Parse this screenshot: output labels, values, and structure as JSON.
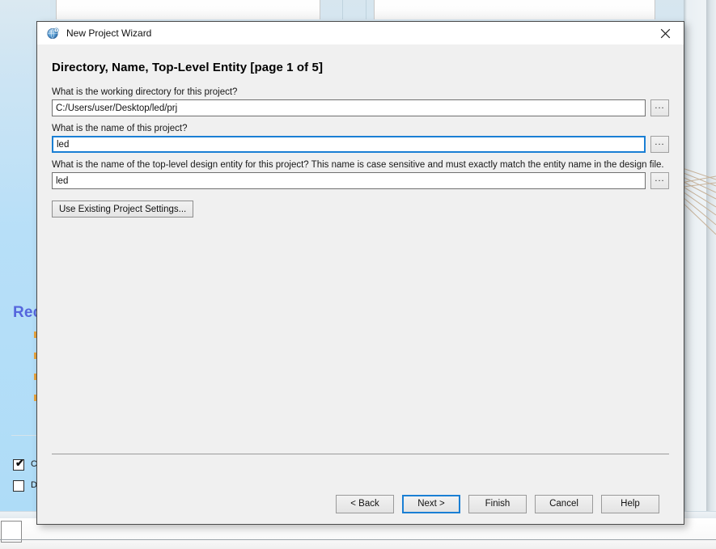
{
  "background": {
    "heading": "Rec",
    "checkbox_1": {
      "label": "C",
      "checked": true,
      "mark": "✔"
    },
    "checkbox_2": {
      "label": "D",
      "checked": false,
      "mark": ""
    }
  },
  "dialog": {
    "titlebar": {
      "title": "New Project Wizard",
      "icon": "globe-icon",
      "close_icon": "close-icon"
    },
    "page_heading": "Directory, Name, Top-Level Entity [page 1 of 5]",
    "fields": [
      {
        "label": "What is the working directory for this project?",
        "value": "C:/Users/user/Desktop/led/prj",
        "placeholder": "",
        "focused": false,
        "browse_label": "...",
        "name": "working-directory"
      },
      {
        "label": "What is the name of this project?",
        "value": "led",
        "placeholder": "",
        "focused": true,
        "browse_label": "...",
        "name": "project-name"
      },
      {
        "label": "What is the name of the top-level design entity for this project? This name is case sensitive and must exactly match the entity name in the design file.",
        "value": "led",
        "placeholder": "",
        "focused": false,
        "browse_label": "...",
        "name": "top-level-entity"
      }
    ],
    "use_existing_label": "Use Existing Project Settings...",
    "footer_buttons": [
      {
        "label": "< Back",
        "name": "back-button",
        "default": false
      },
      {
        "label": "Next >",
        "name": "next-button",
        "default": true
      },
      {
        "label": "Finish",
        "name": "finish-button",
        "default": false
      },
      {
        "label": "Cancel",
        "name": "cancel-button",
        "default": false
      },
      {
        "label": "Help",
        "name": "help-button",
        "default": false
      }
    ]
  },
  "colors": {
    "focus_blue": "#1a7fd4",
    "dialog_bg": "#f0f0f0",
    "heading_blue": "#5566dd",
    "bullet_orange": "#e8a33d"
  }
}
